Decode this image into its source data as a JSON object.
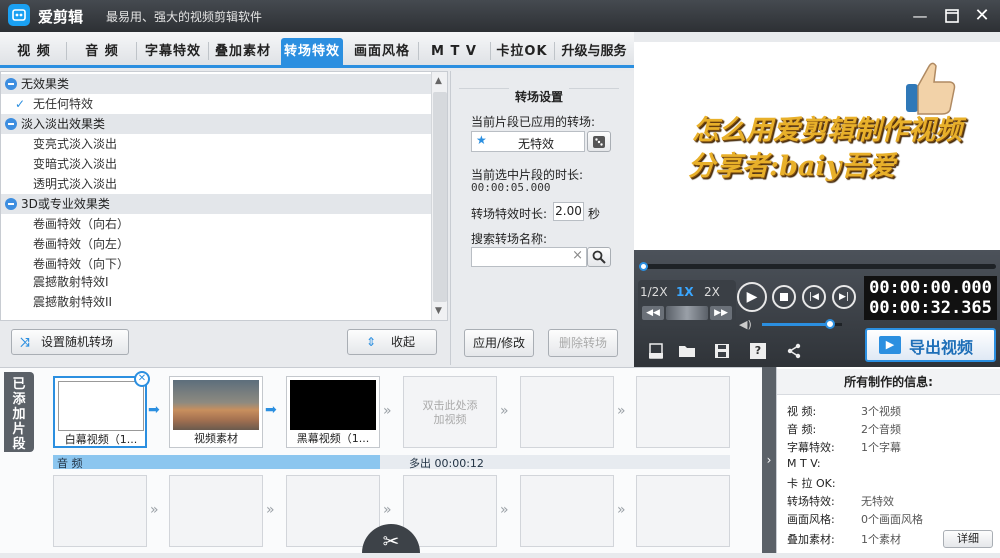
{
  "app": {
    "name": "爱剪辑",
    "slogan": "最易用、强大的视频剪辑软件"
  },
  "tabs": [
    "视 频",
    "音 频",
    "字幕特效",
    "叠加素材",
    "转场特效",
    "画面风格",
    "M T V",
    "卡拉OK",
    "升级与服务"
  ],
  "active_tab": "转场特效",
  "list": [
    {
      "type": "cat",
      "label": "无效果类"
    },
    {
      "type": "item",
      "label": "无任何特效",
      "checked": true
    },
    {
      "type": "cat",
      "label": "淡入淡出效果类"
    },
    {
      "type": "item",
      "label": "变亮式淡入淡出"
    },
    {
      "type": "item",
      "label": "变暗式淡入淡出"
    },
    {
      "type": "item",
      "label": "透明式淡入淡出"
    },
    {
      "type": "cat",
      "label": "3D或专业效果类"
    },
    {
      "type": "item",
      "label": "卷画特效（向右）"
    },
    {
      "type": "item",
      "label": "卷画特效（向左）"
    },
    {
      "type": "item",
      "label": "卷画特效（向下）"
    },
    {
      "type": "item",
      "label": "震撼散射特效I"
    },
    {
      "type": "item",
      "label": "震撼散射特效II"
    }
  ],
  "buttons": {
    "random": "设置随机转场",
    "collapse": "收起",
    "apply": "应用/修改",
    "delete": "删除转场",
    "export": "导出视频"
  },
  "settings": {
    "title": "转场设置",
    "applied_label": "当前片段已应用的转场:",
    "applied_value": "无特效",
    "duration_label": "当前选中片段的时长:",
    "duration_value": "00:00:05.000",
    "effect_dur_label": "转场特效时长:",
    "effect_dur_value": "2.00",
    "effect_dur_unit": "秒",
    "search_label": "搜索转场名称:",
    "search_value": ""
  },
  "preview": {
    "line1": "怎么用爱剪辑制作视频",
    "line2": "分享者:baiy吾爱"
  },
  "player": {
    "speeds": [
      "1/2X",
      "1X",
      "2X"
    ],
    "active_speed": "1X",
    "time_current": "00:00:00.000",
    "time_total": "00:00:32.365",
    "progress": 0,
    "volume": 0.85
  },
  "timeline": {
    "side_label": "已添加片段",
    "clips": [
      "白幕视频（1...",
      "视频素材",
      "黑幕视频（1..."
    ],
    "add_hint": "双击此处添加视频",
    "audio_label": "音 频",
    "audio_note": "多出 00:00:12"
  },
  "info": {
    "title": "所有制作的信息:",
    "rows": [
      {
        "k": "视    频:",
        "v": "3个视频"
      },
      {
        "k": "音    频:",
        "v": "2个音频"
      },
      {
        "k": "字幕特效:",
        "v": "1个字幕"
      },
      {
        "k": "M  T  V:",
        "v": ""
      },
      {
        "k": "卡 拉 OK:",
        "v": ""
      },
      {
        "k": "转场特效:",
        "v": "无特效"
      },
      {
        "k": "画面风格:",
        "v": "0个画面风格"
      },
      {
        "k": "叠加素材:",
        "v": "1个素材"
      }
    ],
    "detail_button": "详细"
  },
  "colors": {
    "accent": "#2b8fe0",
    "titlebar": "#34383d",
    "brand": "#1aa0f2"
  },
  "icons": [
    "settings-dice-icon",
    "new-project-icon",
    "open-folder-icon",
    "save-icon",
    "help-icon",
    "share-icon",
    "scissors-icon"
  ]
}
